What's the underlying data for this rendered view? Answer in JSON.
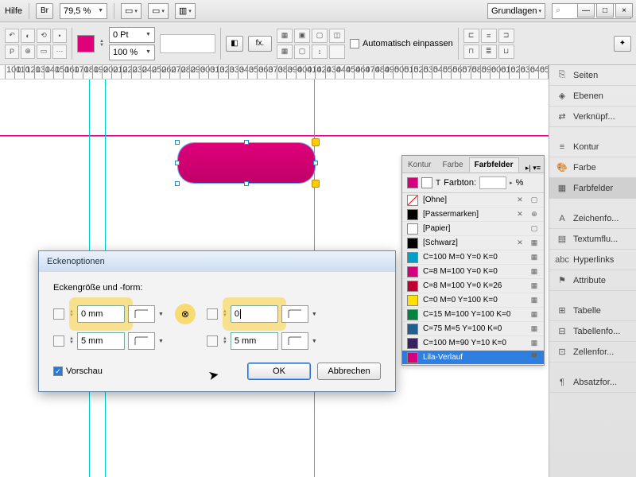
{
  "topbar": {
    "help": "Hilfe",
    "bridge": "Br",
    "zoom": "79,5 %",
    "mode": "Grundlagen",
    "search_icon": "⌕"
  },
  "win": {
    "min": "—",
    "max": "□",
    "close": "×"
  },
  "toolbar": {
    "stroke_val": "0 Pt",
    "pct": "100 %",
    "fx": "fx.",
    "auto_fit": "Automatisch einpassen"
  },
  "ruler_start": 100,
  "ruler_step": 10,
  "ruler_count": 57,
  "rail": [
    {
      "icon": "⎘",
      "label": "Seiten"
    },
    {
      "icon": "◈",
      "label": "Ebenen"
    },
    {
      "icon": "⇄",
      "label": "Verknüpf..."
    },
    {
      "spacer": true
    },
    {
      "icon": "≡",
      "label": "Kontur"
    },
    {
      "icon": "🎨",
      "label": "Farbe"
    },
    {
      "icon": "▦",
      "label": "Farbfelder",
      "active": true
    },
    {
      "spacer": true
    },
    {
      "icon": "A",
      "label": "Zeichenfo..."
    },
    {
      "icon": "▤",
      "label": "Textumflu..."
    },
    {
      "icon": "abc",
      "label": "Hyperlinks"
    },
    {
      "icon": "⚑",
      "label": "Attribute"
    },
    {
      "spacer": true
    },
    {
      "icon": "⊞",
      "label": "Tabelle"
    },
    {
      "icon": "⊟",
      "label": "Tabellenfo..."
    },
    {
      "icon": "⊡",
      "label": "Zellenfor..."
    },
    {
      "spacer": true
    },
    {
      "icon": "¶",
      "label": "Absatzfor..."
    }
  ],
  "swatches": {
    "tabs": [
      "Kontur",
      "Farbe",
      "Farbfelder"
    ],
    "active_tab": 2,
    "tint_label": "Farbton:",
    "tint_suffix": "%",
    "rows": [
      {
        "color": "#fff",
        "border": "red-diag",
        "name": "[Ohne]",
        "locked": true,
        "reg": false,
        "none": true
      },
      {
        "color": "#000",
        "name": "[Passermarken]",
        "locked": true,
        "reg": true
      },
      {
        "color": "#fff",
        "name": "[Papier]"
      },
      {
        "color": "#000",
        "name": "[Schwarz]",
        "locked": true,
        "cmyk": true
      },
      {
        "color": "#00a0c8",
        "name": "C=100 M=0 Y=0 K=0",
        "cmyk": true
      },
      {
        "color": "#d4007c",
        "name": "C=8 M=100 Y=0 K=0",
        "cmyk": true
      },
      {
        "color": "#c00030",
        "name": "C=8 M=100 Y=0 K=26",
        "cmyk": true
      },
      {
        "color": "#ffe000",
        "name": "C=0 M=0 Y=100 K=0",
        "cmyk": true
      },
      {
        "color": "#00843d",
        "name": "C=15 M=100 Y=100 K=0",
        "cmyk": true
      },
      {
        "color": "#206090",
        "name": "C=75 M=5 Y=100 K=0",
        "cmyk": true
      },
      {
        "color": "#3a2060",
        "name": "C=100 M=90 Y=10 K=0",
        "cmyk": true
      },
      {
        "color": "#d4007c",
        "name": "Lila-Verlauf",
        "sel": true,
        "grad": true
      }
    ]
  },
  "dialog": {
    "title": "Eckenoptionen",
    "group_label": "Eckengröße und -form:",
    "tl": "0 mm",
    "tr": "0",
    "bl": "5 mm",
    "br": "5 mm",
    "preview": "Vorschau",
    "ok": "OK",
    "cancel": "Abbrechen",
    "chain": "⊗"
  }
}
